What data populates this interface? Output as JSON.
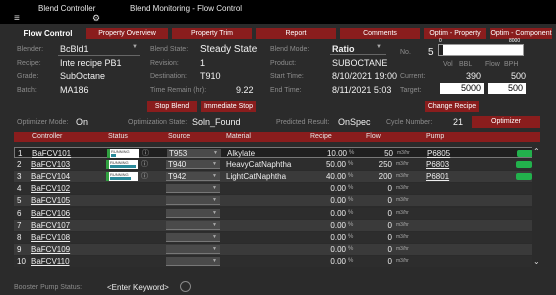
{
  "titlebar": {
    "app_name": "Blend Controller",
    "window_title": "Blend Monitoring - Flow Control"
  },
  "tabs": [
    "Flow Control",
    "Property Overview",
    "Property Trim",
    "Report",
    "Comments",
    "Optim - Property",
    "Optim - Component"
  ],
  "info": {
    "blender_label": "Blender:",
    "blender_value": "BcBld1",
    "recipe_label": "Recipe:",
    "recipe_value": "Inte recipe PB1",
    "grade_label": "Grade:",
    "grade_value": "SubOctane",
    "batch_label": "Batch:",
    "batch_value": "MA186",
    "blend_state_label": "Blend State:",
    "blend_state_value": "Steady State",
    "revision_label": "Revision:",
    "revision_value": "1",
    "destination_label": "Destination:",
    "destination_value": "T910",
    "time_remain_label": "Time Remain (hr):",
    "time_remain_value": "9.22",
    "blend_mode_label": "Blend Mode:",
    "blend_mode_value": "Ratio",
    "product_label": "Product:",
    "product_value": "SUBOCTANE",
    "start_time_label": "Start Time:",
    "start_time_value": "8/10/2021 19:00",
    "end_time_label": "End Time:",
    "end_time_value": "8/11/2021 5:03",
    "no_label": "No.",
    "no_value": "5",
    "progress_min": "0",
    "progress_max": "8000",
    "vol_label": "Vol",
    "bbl_label": "BBL",
    "flow_label": "Flow",
    "bph_label": "BPH",
    "current_label": "Current:",
    "current_vol": "390",
    "current_flow": "500",
    "target_label": "Target:",
    "target_vol": "5000",
    "target_flow": "500"
  },
  "buttons": {
    "stop_blend": "Stop Blend",
    "immediate_stop": "Immediate Stop",
    "change_recipe": "Change Recipe",
    "optimizer": "Optimizer"
  },
  "optimizer_bar": {
    "mode_label": "Optimizer Mode:",
    "mode_value": "On",
    "state_label": "Optimization State:",
    "state_value": "Soln_Found",
    "predicted_label": "Predicted Result:",
    "predicted_value": "OnSpec",
    "cycle_label": "Cycle Number:",
    "cycle_value": "21"
  },
  "table": {
    "headers": [
      "Controller",
      "Status",
      "Source",
      "Material",
      "Recipe",
      "Flow",
      "Pump"
    ],
    "rows": [
      {
        "no": "1",
        "controller": "BaFCV101",
        "status": "RUNNING",
        "source": "T953",
        "material": "Alkylate",
        "recipe": "10.00",
        "flow": "50",
        "pump": "P6805"
      },
      {
        "no": "2",
        "controller": "BaFCV103",
        "status": "RUNNING",
        "source": "T940",
        "material": "HeavyCatNaphtha",
        "recipe": "50.00",
        "flow": "250",
        "pump": "P6803"
      },
      {
        "no": "3",
        "controller": "BaFCV104",
        "status": "RUNNING",
        "source": "T942",
        "material": "LightCatNaphtha",
        "recipe": "40.00",
        "flow": "200",
        "pump": "P6801"
      },
      {
        "no": "4",
        "controller": "BaFCV102",
        "status": "",
        "source": "",
        "material": "",
        "recipe": "0.00",
        "flow": "0",
        "pump": ""
      },
      {
        "no": "5",
        "controller": "BaFCV105",
        "status": "",
        "source": "",
        "material": "",
        "recipe": "0.00",
        "flow": "0",
        "pump": ""
      },
      {
        "no": "6",
        "controller": "BaFCV106",
        "status": "",
        "source": "",
        "material": "",
        "recipe": "0.00",
        "flow": "0",
        "pump": ""
      },
      {
        "no": "7",
        "controller": "BaFCV107",
        "status": "",
        "source": "",
        "material": "",
        "recipe": "0.00",
        "flow": "0",
        "pump": ""
      },
      {
        "no": "8",
        "controller": "BaFCV108",
        "status": "",
        "source": "",
        "material": "",
        "recipe": "0.00",
        "flow": "0",
        "pump": ""
      },
      {
        "no": "9",
        "controller": "BaFCV109",
        "status": "",
        "source": "",
        "material": "",
        "recipe": "0.00",
        "flow": "0",
        "pump": ""
      },
      {
        "no": "10",
        "controller": "BaFCV110",
        "status": "",
        "source": "",
        "material": "",
        "recipe": "0.00",
        "flow": "0",
        "pump": ""
      }
    ],
    "pct_unit": "%",
    "flow_unit": "m3/hr"
  },
  "footer": {
    "booster_label": "Booster Pump Status:",
    "keyword_placeholder": "<Enter Keyword>"
  },
  "colors": {
    "accent_red": "#8a1d1d",
    "running_green": "#30a040",
    "pump_green": "#22b14c"
  }
}
